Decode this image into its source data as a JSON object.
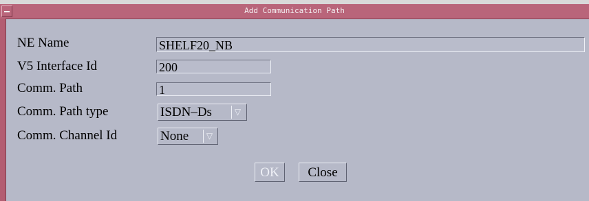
{
  "window": {
    "title": "Add Communication Path"
  },
  "form": {
    "ne_name_label": "NE Name",
    "ne_name_value": "SHELF20_NB",
    "v5_label": "V5 Interface Id",
    "v5_value": "200",
    "comm_path_label": "Comm. Path",
    "comm_path_value": "1",
    "path_type_label": "Comm. Path type",
    "path_type_value": "ISDN–Ds",
    "channel_label": "Comm. Channel Id",
    "channel_value": "None"
  },
  "buttons": {
    "ok": "OK",
    "close": "Close"
  },
  "icons": {
    "window_menu": "window-menu-icon",
    "dropdown": "chevron-down-icon"
  }
}
